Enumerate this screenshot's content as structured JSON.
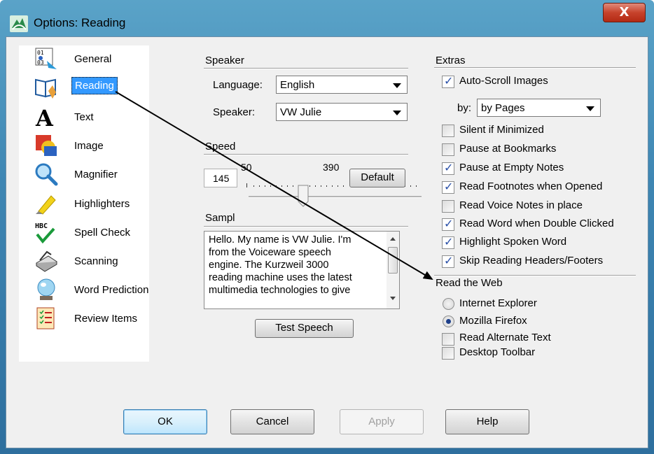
{
  "window": {
    "title": "Options: Reading",
    "close_glyph": "X"
  },
  "sidebar": {
    "items": [
      {
        "label": "General",
        "icon": "general-icon"
      },
      {
        "label": "Reading",
        "icon": "book-reading-icon",
        "selected": true
      },
      {
        "label": "Text",
        "icon": "text-a-icon"
      },
      {
        "label": "Image",
        "icon": "image-icon"
      },
      {
        "label": "Magnifier",
        "icon": "magnifier-icon"
      },
      {
        "label": "Highlighters",
        "icon": "highlighter-icon"
      },
      {
        "label": "Spell Check",
        "icon": "spell-check-icon"
      },
      {
        "label": "Scanning",
        "icon": "scanner-icon"
      },
      {
        "label": "Word Prediction",
        "icon": "crystal-ball-icon"
      },
      {
        "label": "Review Items",
        "icon": "review-list-icon"
      }
    ]
  },
  "speaker": {
    "section": "Speaker",
    "language_label": "Language:",
    "language_value": "English",
    "speaker_label": "Speaker:",
    "speaker_value": "VW Julie"
  },
  "speed": {
    "section": "Speed",
    "value": "145",
    "min_label": "50",
    "max_label": "390",
    "default_button": "Default"
  },
  "sample": {
    "section": "Sampl",
    "lines": [
      "Hello. My name is VW Julie. I'm",
      "from the Voiceware speech",
      "engine. The Kurzweil 3000",
      "reading machine uses the latest",
      "multimedia technologies to give"
    ],
    "test_button": "Test Speech"
  },
  "extras": {
    "section": "Extras",
    "auto_scroll": {
      "label": "Auto-Scroll Images",
      "checked": true
    },
    "by_label": "by:",
    "by_value": "by Pages",
    "options": [
      {
        "label": "Silent if Minimized",
        "checked": false
      },
      {
        "label": "Pause at Bookmarks",
        "checked": false
      },
      {
        "label": "Pause at Empty Notes",
        "checked": true
      },
      {
        "label": "Read Footnotes when Opened",
        "checked": true
      },
      {
        "label": "Read Voice Notes in place",
        "checked": false
      },
      {
        "label": "Read Word when Double Clicked",
        "checked": true
      },
      {
        "label": "Highlight Spoken Word",
        "checked": true
      },
      {
        "label": "Skip Reading Headers/Footers",
        "checked": true
      }
    ]
  },
  "web": {
    "section": "Read the Web",
    "radios": [
      {
        "label": "Internet Explorer",
        "selected": false
      },
      {
        "label": "Mozilla Firefox",
        "selected": true
      }
    ],
    "checks": [
      {
        "label": "Read Alternate Text",
        "checked": false
      },
      {
        "label": "Desktop Toolbar",
        "checked": false
      }
    ]
  },
  "buttons": {
    "ok": "OK",
    "cancel": "Cancel",
    "apply": "Apply",
    "help": "Help"
  },
  "colors": {
    "title_bar": "#3e86b3",
    "selection": "#3399ff",
    "close_button": "#c7432c",
    "check_mark": "#2a50a8"
  }
}
